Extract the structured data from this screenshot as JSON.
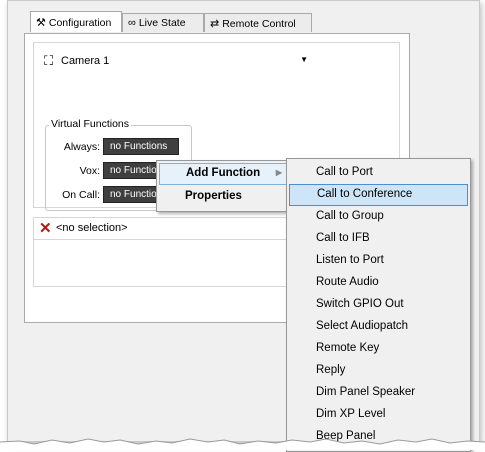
{
  "tabs": [
    {
      "label": "Configuration",
      "icon": "tools-icon",
      "active": true
    },
    {
      "label": "Live State",
      "icon": "binoculars-icon",
      "active": false
    },
    {
      "label": "Remote Control",
      "icon": "remote-icon",
      "active": false
    }
  ],
  "camera": {
    "selected": "Camera 1",
    "icon": "camera-icon"
  },
  "virtual_functions": {
    "legend": "Virtual Functions",
    "rows": [
      {
        "label": "Always:",
        "value": "no Functions"
      },
      {
        "label": "Vox:",
        "value": "no Functions"
      },
      {
        "label": "On Call:",
        "value": "no Functions"
      }
    ]
  },
  "selection": {
    "text": "<no selection>",
    "icon": "x-icon"
  },
  "context_menu": {
    "items": [
      {
        "label": "Add Function",
        "has_submenu": true,
        "highlighted": true
      },
      {
        "label": "Properties",
        "has_submenu": false,
        "highlighted": false
      }
    ]
  },
  "submenu": {
    "items": [
      {
        "label": "Call to Port",
        "highlighted": false
      },
      {
        "label": "Call to Conference",
        "highlighted": true
      },
      {
        "label": "Call to Group",
        "highlighted": false
      },
      {
        "label": "Call to IFB",
        "highlighted": false
      },
      {
        "label": "Listen to Port",
        "highlighted": false
      },
      {
        "label": "Route Audio",
        "highlighted": false
      },
      {
        "label": "Switch GPIO Out",
        "highlighted": false
      },
      {
        "label": "Select Audiopatch",
        "highlighted": false
      },
      {
        "label": "Remote Key",
        "highlighted": false
      },
      {
        "label": "Reply",
        "highlighted": false
      },
      {
        "label": "Dim Panel Speaker",
        "highlighted": false
      },
      {
        "label": "Dim XP Level",
        "highlighted": false
      },
      {
        "label": "Beep Panel",
        "highlighted": false
      }
    ]
  },
  "colors": {
    "highlight": "#cde5f7",
    "highlight_border": "#4a90d0",
    "function_box": "#3f3f3f"
  }
}
